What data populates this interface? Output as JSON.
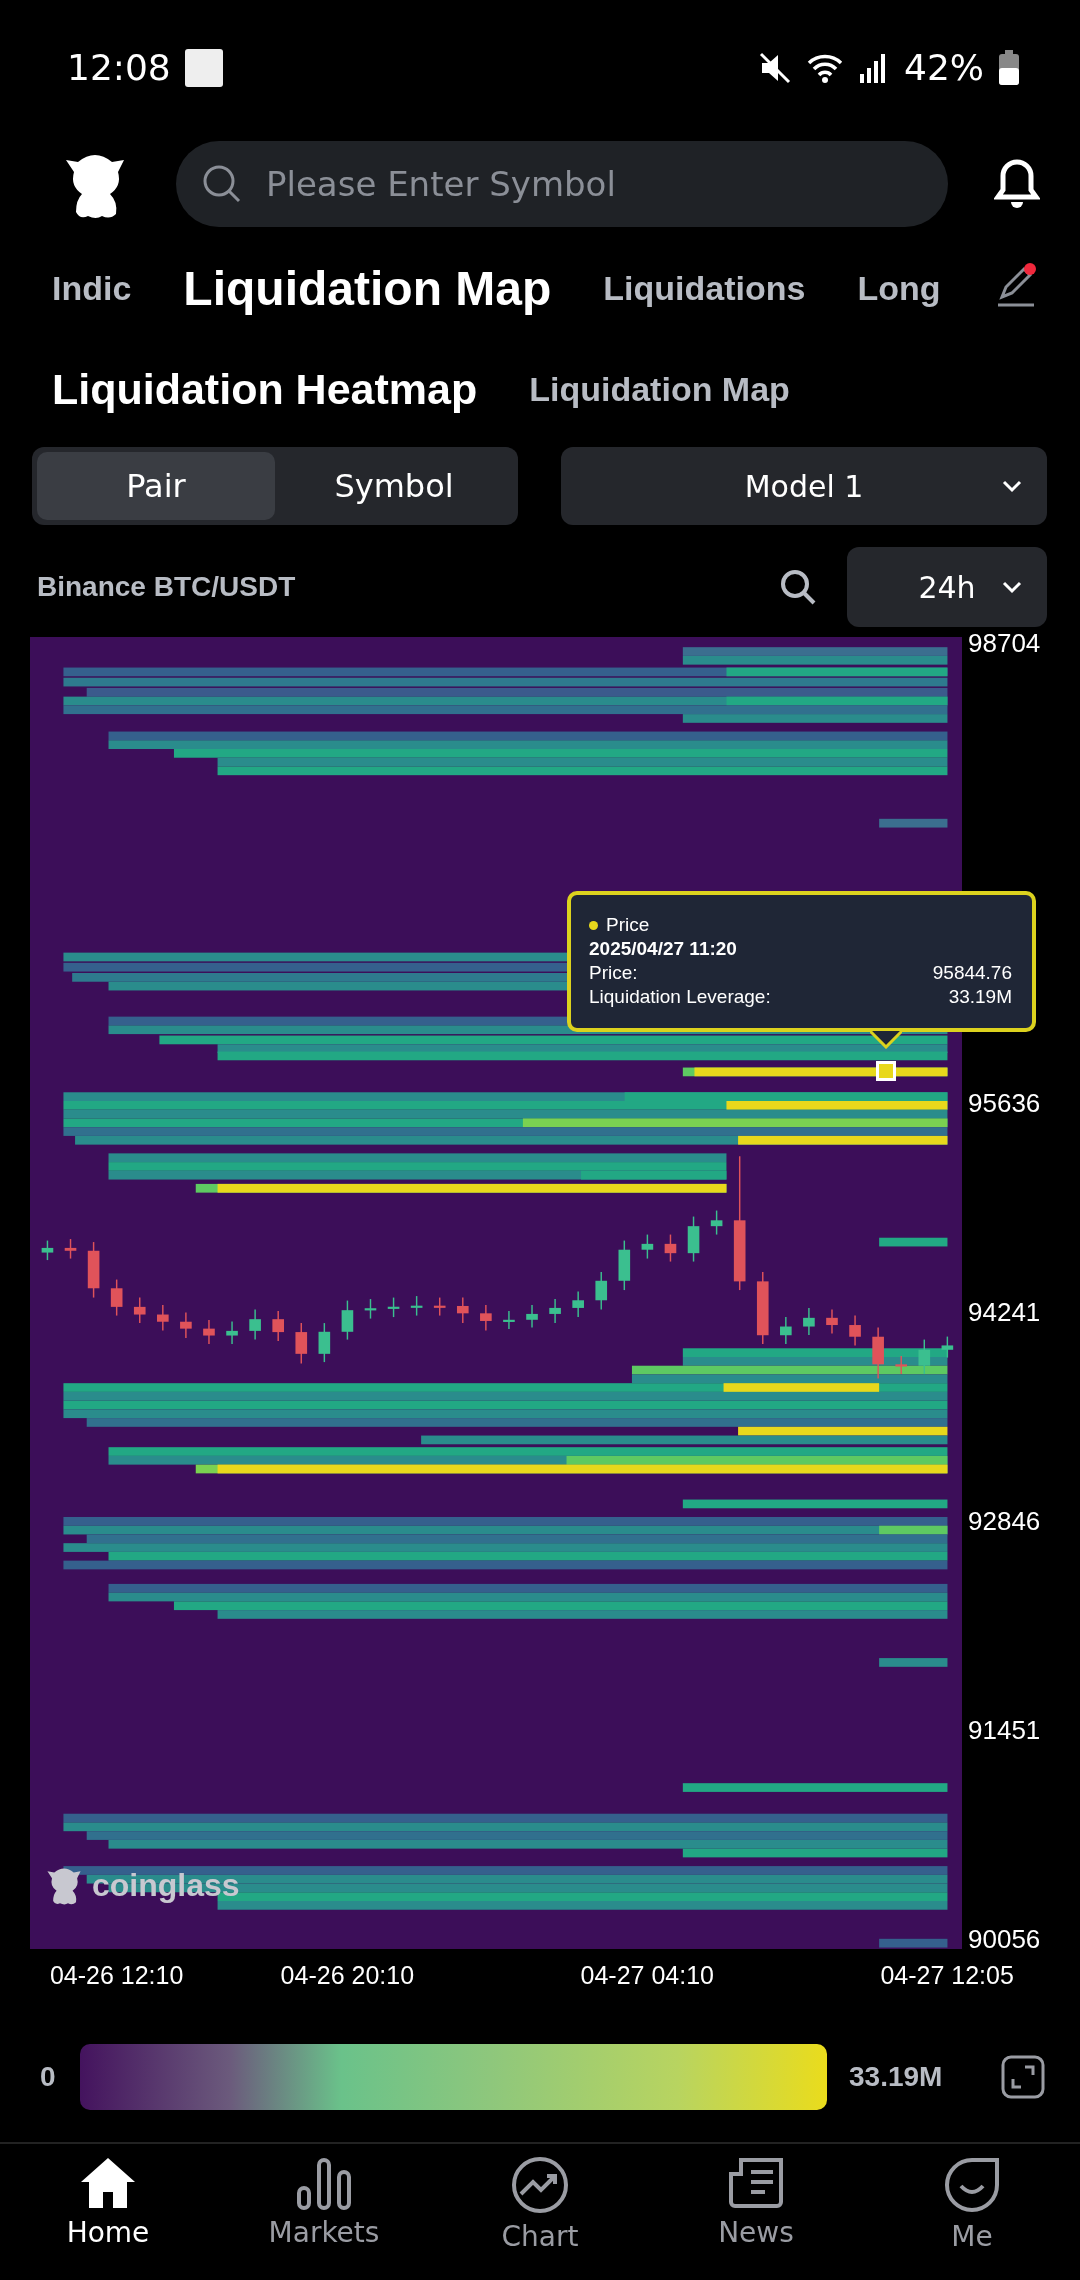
{
  "status_bar": {
    "time": "12:08",
    "battery": "42%"
  },
  "search": {
    "placeholder": "Please Enter Symbol"
  },
  "tabs": [
    {
      "label": "Indic",
      "selected": false
    },
    {
      "label": "Liquidation Map",
      "selected": true
    },
    {
      "label": "Liquidations",
      "selected": false
    },
    {
      "label": "Long",
      "selected": false
    }
  ],
  "edit_badge": true,
  "sub_tabs": [
    {
      "label": "Liquidation Heatmap",
      "selected": true
    },
    {
      "label": "Liquidation Map",
      "selected": false
    }
  ],
  "segments": [
    {
      "label": "Pair",
      "selected": true
    },
    {
      "label": "Symbol",
      "selected": false
    }
  ],
  "model_dropdown": {
    "value": "Model 1"
  },
  "pair_label": "Binance BTC/USDT",
  "range_dropdown": {
    "value": "24h"
  },
  "chart": {
    "chart_data": {
      "type": "candlestick",
      "categories": [
        null,
        null,
        null,
        "04-26 12:10",
        null,
        null,
        null,
        null,
        null,
        null,
        null,
        null,
        null,
        "04-26 20:10",
        null,
        null,
        null,
        null,
        null,
        null,
        null,
        null,
        null,
        null,
        null,
        null,
        "04-27 04:10",
        null,
        null,
        null,
        null,
        null,
        null,
        null,
        null,
        null,
        null,
        null,
        null,
        "04-27 12:05"
      ],
      "ylim": [
        89998,
        98743
      ],
      "ohlc": [
        [
          94640,
          94720,
          94590,
          94671
        ],
        [
          94671,
          94730,
          94600,
          94652
        ],
        [
          94652,
          94710,
          94340,
          94402
        ],
        [
          94402,
          94460,
          94220,
          94278
        ],
        [
          94278,
          94340,
          94170,
          94227
        ],
        [
          94227,
          94290,
          94120,
          94179
        ],
        [
          94179,
          94240,
          94070,
          94133
        ],
        [
          94133,
          94190,
          94030,
          94087
        ],
        [
          94087,
          94180,
          94030,
          94118
        ],
        [
          94118,
          94260,
          94060,
          94196
        ],
        [
          94196,
          94250,
          94050,
          94110
        ],
        [
          94110,
          94170,
          93900,
          93965
        ],
        [
          93965,
          94170,
          93910,
          94112
        ],
        [
          94112,
          94320,
          94060,
          94256
        ],
        [
          94256,
          94330,
          94200,
          94269
        ],
        [
          94269,
          94340,
          94210,
          94279
        ],
        [
          94279,
          94350,
          94220,
          94286
        ],
        [
          94286,
          94340,
          94220,
          94284
        ],
        [
          94284,
          94340,
          94170,
          94235
        ],
        [
          94235,
          94290,
          94120,
          94184
        ],
        [
          94184,
          94250,
          94130,
          94192
        ],
        [
          94192,
          94290,
          94140,
          94231
        ],
        [
          94231,
          94330,
          94170,
          94271
        ],
        [
          94271,
          94380,
          94210,
          94322
        ],
        [
          94322,
          94510,
          94260,
          94452
        ],
        [
          94452,
          94720,
          94390,
          94659
        ],
        [
          94659,
          94760,
          94600,
          94698
        ],
        [
          94698,
          94760,
          94580,
          94636
        ],
        [
          94636,
          94880,
          94580,
          94816
        ],
        [
          94816,
          94920,
          94760,
          94855
        ],
        [
          94855,
          95282,
          94390,
          94448
        ],
        [
          94448,
          94510,
          94030,
          94089
        ],
        [
          94089,
          94210,
          94030,
          94147
        ],
        [
          94147,
          94270,
          94090,
          94205
        ],
        [
          94205,
          94260,
          94100,
          94157
        ],
        [
          94157,
          94220,
          94020,
          94079
        ],
        [
          94079,
          94140,
          93800,
          93895
        ],
        [
          93895,
          93950,
          93830,
          93886
        ],
        [
          93886,
          94060,
          93830,
          93992
        ],
        [
          93992,
          94080,
          93940,
          94021
        ]
      ],
      "yticks": [
        {
          "value": 98704,
          "label": "98704"
        },
        {
          "value": 95636,
          "label": "95636"
        },
        {
          "value": 94241,
          "label": "94241"
        },
        {
          "value": 92846,
          "label": "92846"
        },
        {
          "value": 91451,
          "label": "91451"
        },
        {
          "value": 90056,
          "label": "90056"
        }
      ]
    },
    "logo_text": "coinglass",
    "tooltip": {
      "series": "Price",
      "time": "2025/04/27 11:20",
      "rows": [
        {
          "label": "Price:",
          "value": "95844.76"
        },
        {
          "label": "Liquidation Leverage:",
          "value": "33.19M"
        }
      ]
    }
  },
  "legend": {
    "min": "0",
    "max": "33.19M"
  },
  "nav": [
    {
      "label": "Home",
      "kind": "home",
      "selected": true
    },
    {
      "label": "Markets",
      "kind": "markets",
      "selected": false
    },
    {
      "label": "Chart",
      "kind": "chart",
      "selected": false
    },
    {
      "label": "News",
      "kind": "news",
      "selected": false
    },
    {
      "label": "Me",
      "kind": "me",
      "selected": false
    }
  ]
}
